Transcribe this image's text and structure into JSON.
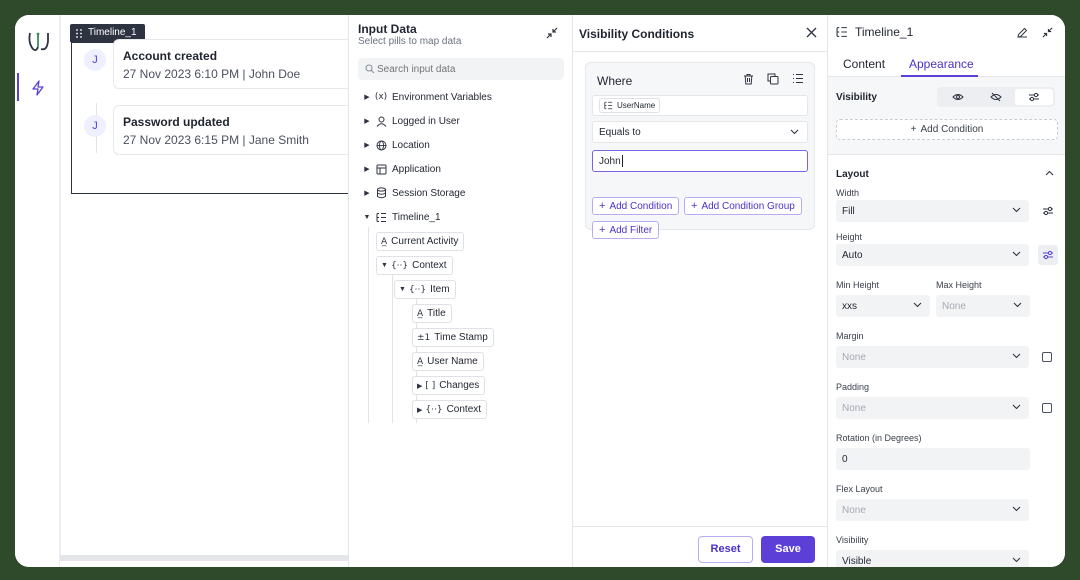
{
  "nav": {
    "logo_icon": "app-logo",
    "bolt_icon": "lightning-icon"
  },
  "canvas": {
    "component_tag": "Timeline_1",
    "items": [
      {
        "avatar": "J",
        "title": "Account created",
        "subtitle": "27 Nov 2023 6:10 PM | John Doe"
      },
      {
        "avatar": "J",
        "title": "Password updated",
        "subtitle": "27 Nov 2023 6:15 PM | Jane Smith"
      }
    ]
  },
  "input_panel": {
    "title": "Input Data",
    "subtitle": "Select pills to map data",
    "search_placeholder": "Search input data",
    "tree": [
      {
        "label": "Environment Variables",
        "icon": "(x)"
      },
      {
        "label": "Logged in User",
        "icon": "user"
      },
      {
        "label": "Location",
        "icon": "globe"
      },
      {
        "label": "Application",
        "icon": "app"
      },
      {
        "label": "Session Storage",
        "icon": "db"
      },
      {
        "label": "Timeline_1",
        "icon": "list"
      }
    ],
    "timeline_children": {
      "current_activity": "Current Activity",
      "context": "Context",
      "item": "Item",
      "item_children": [
        "Title",
        "Time Stamp",
        "User Name"
      ],
      "changes": "Changes",
      "context2": "Context"
    }
  },
  "visibility_panel": {
    "title": "Visibility Conditions",
    "where_label": "Where",
    "field_pill": "UserName",
    "operator": "Equals to",
    "value": "John",
    "add_condition": "Add Condition",
    "add_condition_group": "Add Condition Group",
    "add_filter": "Add Filter",
    "reset": "Reset",
    "save": "Save"
  },
  "props_panel": {
    "component_name": "Timeline_1",
    "tabs": [
      "Content",
      "Appearance"
    ],
    "active_tab": "Appearance",
    "visibility_label": "Visibility",
    "add_condition": "Add Condition",
    "layout_label": "Layout",
    "width_label": "Width",
    "width_value": "Fill",
    "height_label": "Height",
    "height_value": "Auto",
    "min_height_label": "Min Height",
    "min_height_value": "xxs",
    "max_height_label": "Max Height",
    "max_height_value": "None",
    "margin_label": "Margin",
    "margin_value": "None",
    "padding_label": "Padding",
    "padding_value": "None",
    "rotation_label": "Rotation (in Degrees)",
    "rotation_value": "0",
    "flex_label": "Flex Layout",
    "flex_value": "None",
    "visibility2_label": "Visibility",
    "visibility2_value": "Visible"
  },
  "colors": {
    "accent": "#5b3fd6",
    "frame_bg": "#2e4a2a"
  }
}
